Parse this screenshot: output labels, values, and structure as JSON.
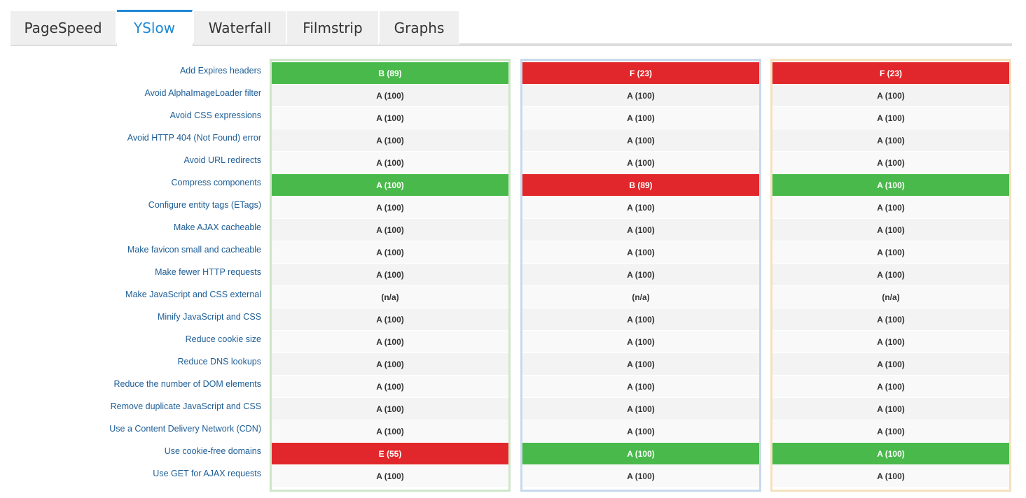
{
  "tabs": [
    {
      "label": "PageSpeed",
      "active": false
    },
    {
      "label": "YSlow",
      "active": true
    },
    {
      "label": "Waterfall",
      "active": false
    },
    {
      "label": "Filmstrip",
      "active": false
    },
    {
      "label": "Graphs",
      "active": false
    }
  ],
  "rules": [
    "Add Expires headers",
    "Avoid AlphaImageLoader filter",
    "Avoid CSS expressions",
    "Avoid HTTP 404 (Not Found) error",
    "Avoid URL redirects",
    "Compress components",
    "Configure entity tags (ETags)",
    "Make AJAX cacheable",
    "Make favicon small and cacheable",
    "Make fewer HTTP requests",
    "Make JavaScript and CSS external",
    "Minify JavaScript and CSS",
    "Reduce cookie size",
    "Reduce DNS lookups",
    "Reduce the number of DOM elements",
    "Remove duplicate JavaScript and CSS",
    "Use a Content Delivery Network (CDN)",
    "Use cookie-free domains",
    "Use GET for AJAX requests"
  ],
  "columns": [
    {
      "border_color": "#cfe6c9",
      "cells": [
        {
          "value": "B (89)",
          "status": "good"
        },
        {
          "value": "A (100)",
          "status": "plain"
        },
        {
          "value": "A (100)",
          "status": "plain"
        },
        {
          "value": "A (100)",
          "status": "plain"
        },
        {
          "value": "A (100)",
          "status": "plain"
        },
        {
          "value": "A (100)",
          "status": "good"
        },
        {
          "value": "A (100)",
          "status": "plain"
        },
        {
          "value": "A (100)",
          "status": "plain"
        },
        {
          "value": "A (100)",
          "status": "plain"
        },
        {
          "value": "A (100)",
          "status": "plain"
        },
        {
          "value": "(n/a)",
          "status": "plain"
        },
        {
          "value": "A (100)",
          "status": "plain"
        },
        {
          "value": "A (100)",
          "status": "plain"
        },
        {
          "value": "A (100)",
          "status": "plain"
        },
        {
          "value": "A (100)",
          "status": "plain"
        },
        {
          "value": "A (100)",
          "status": "plain"
        },
        {
          "value": "A (100)",
          "status": "plain"
        },
        {
          "value": "E (55)",
          "status": "bad"
        },
        {
          "value": "A (100)",
          "status": "plain"
        }
      ]
    },
    {
      "border_color": "#c7d9ec",
      "cells": [
        {
          "value": "F (23)",
          "status": "bad"
        },
        {
          "value": "A (100)",
          "status": "plain"
        },
        {
          "value": "A (100)",
          "status": "plain"
        },
        {
          "value": "A (100)",
          "status": "plain"
        },
        {
          "value": "A (100)",
          "status": "plain"
        },
        {
          "value": "B (89)",
          "status": "bad"
        },
        {
          "value": "A (100)",
          "status": "plain"
        },
        {
          "value": "A (100)",
          "status": "plain"
        },
        {
          "value": "A (100)",
          "status": "plain"
        },
        {
          "value": "A (100)",
          "status": "plain"
        },
        {
          "value": "(n/a)",
          "status": "plain"
        },
        {
          "value": "A (100)",
          "status": "plain"
        },
        {
          "value": "A (100)",
          "status": "plain"
        },
        {
          "value": "A (100)",
          "status": "plain"
        },
        {
          "value": "A (100)",
          "status": "plain"
        },
        {
          "value": "A (100)",
          "status": "plain"
        },
        {
          "value": "A (100)",
          "status": "plain"
        },
        {
          "value": "A (100)",
          "status": "good"
        },
        {
          "value": "A (100)",
          "status": "plain"
        }
      ]
    },
    {
      "border_color": "#f4e1bd",
      "cells": [
        {
          "value": "F (23)",
          "status": "bad"
        },
        {
          "value": "A (100)",
          "status": "plain"
        },
        {
          "value": "A (100)",
          "status": "plain"
        },
        {
          "value": "A (100)",
          "status": "plain"
        },
        {
          "value": "A (100)",
          "status": "plain"
        },
        {
          "value": "A (100)",
          "status": "good"
        },
        {
          "value": "A (100)",
          "status": "plain"
        },
        {
          "value": "A (100)",
          "status": "plain"
        },
        {
          "value": "A (100)",
          "status": "plain"
        },
        {
          "value": "A (100)",
          "status": "plain"
        },
        {
          "value": "(n/a)",
          "status": "plain"
        },
        {
          "value": "A (100)",
          "status": "plain"
        },
        {
          "value": "A (100)",
          "status": "plain"
        },
        {
          "value": "A (100)",
          "status": "plain"
        },
        {
          "value": "A (100)",
          "status": "plain"
        },
        {
          "value": "A (100)",
          "status": "plain"
        },
        {
          "value": "A (100)",
          "status": "plain"
        },
        {
          "value": "A (100)",
          "status": "good"
        },
        {
          "value": "A (100)",
          "status": "plain"
        }
      ]
    }
  ],
  "colors": {
    "active_tab": "#1e88d6",
    "good": "#48b94a",
    "bad": "#e1272b",
    "link": "#1d5d96"
  }
}
